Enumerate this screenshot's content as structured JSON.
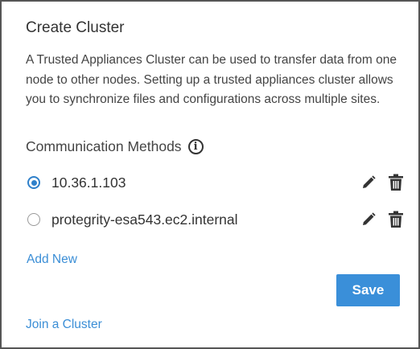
{
  "panel": {
    "title": "Create Cluster",
    "description": "A Trusted Appliances Cluster can be used to transfer data from one node to other nodes. Setting up a trusted appliances cluster allows you to synchronize files and configurations across multiple sites."
  },
  "methods": {
    "header": "Communication Methods",
    "info_icon": "info-icon",
    "items": [
      {
        "label": "10.36.1.103",
        "selected": true
      },
      {
        "label": "protegrity-esa543.ec2.internal",
        "selected": false
      }
    ],
    "edit_icon": "pencil-icon",
    "delete_icon": "trash-icon"
  },
  "actions": {
    "add_new": "Add New",
    "save": "Save",
    "join_cluster": "Join a Cluster"
  },
  "colors": {
    "accent": "#3a8fd9",
    "link": "#3b8ed6",
    "text": "#333333"
  }
}
